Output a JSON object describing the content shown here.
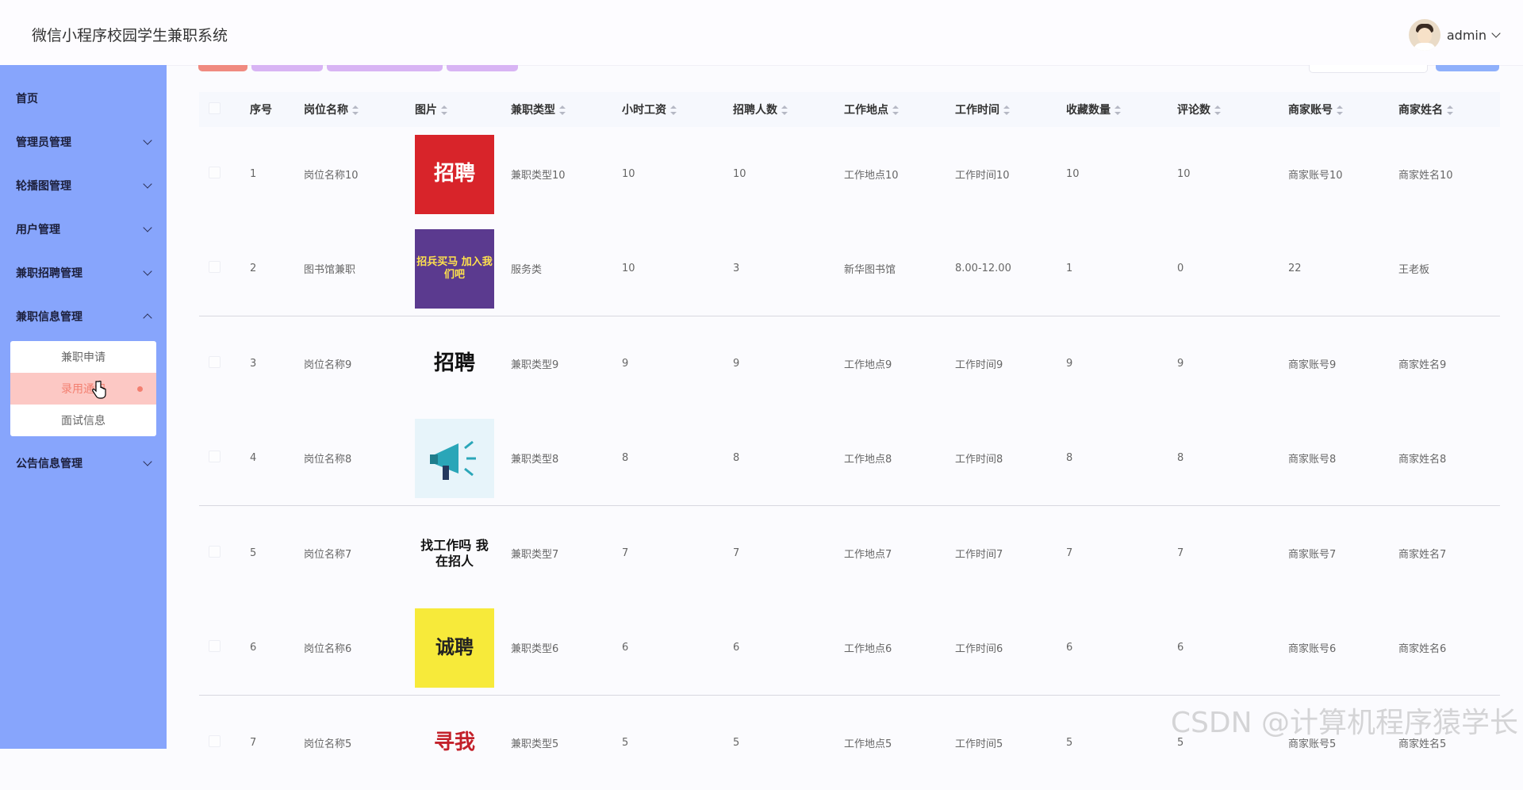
{
  "app": {
    "title": "微信小程序校园学生兼职系统"
  },
  "user": {
    "name": "admin"
  },
  "sidebar": {
    "items": [
      {
        "label": "首页"
      },
      {
        "label": "管理员管理"
      },
      {
        "label": "轮播图管理"
      },
      {
        "label": "用户管理"
      },
      {
        "label": "兼职招聘管理"
      },
      {
        "label": "兼职信息管理"
      },
      {
        "label": "公告信息管理"
      }
    ],
    "submenu": [
      {
        "label": "兼职申请"
      },
      {
        "label": "录用通知"
      },
      {
        "label": "面试信息"
      }
    ]
  },
  "colors": {
    "sidebar": "#87a5fc",
    "accent": "#f37f70",
    "active_bg": "#fcc8c4",
    "header_bg": "#f6f8fd"
  },
  "table": {
    "headers": [
      "序号",
      "岗位名称",
      "图片",
      "兼职类型",
      "小时工资",
      "招聘人数",
      "工作地点",
      "工作时间",
      "收藏数量",
      "评论数",
      "商家账号",
      "商家姓名"
    ],
    "rows": [
      [
        "1",
        "岗位名称10",
        "招聘",
        "兼职类型10",
        "10",
        "10",
        "工作地点10",
        "工作时间10",
        "10",
        "10",
        "商家账号10",
        "商家姓名10"
      ],
      [
        "2",
        "图书馆兼职",
        "招兵买马 加入我们吧",
        "服务类",
        "10",
        "3",
        "新华图书馆",
        "8.00-12.00",
        "1",
        "0",
        "22",
        "王老板"
      ],
      [
        "3",
        "岗位名称9",
        "招聘",
        "兼职类型9",
        "9",
        "9",
        "工作地点9",
        "工作时间9",
        "9",
        "9",
        "商家账号9",
        "商家姓名9"
      ],
      [
        "4",
        "岗位名称8",
        "",
        "兼职类型8",
        "8",
        "8",
        "工作地点8",
        "工作时间8",
        "8",
        "8",
        "商家账号8",
        "商家姓名8"
      ],
      [
        "5",
        "岗位名称7",
        "找工作吗 我在招人",
        "兼职类型7",
        "7",
        "7",
        "工作地点7",
        "工作时间7",
        "7",
        "7",
        "商家账号7",
        "商家姓名7"
      ],
      [
        "6",
        "岗位名称6",
        "诚聘",
        "兼职类型6",
        "6",
        "6",
        "工作地点6",
        "工作时间6",
        "6",
        "6",
        "商家账号6",
        "商家姓名6"
      ],
      [
        "7",
        "岗位名称5",
        "寻我",
        "兼职类型5",
        "5",
        "5",
        "工作地点5",
        "工作时间5",
        "5",
        "5",
        "商家账号5",
        "商家姓名5"
      ]
    ]
  },
  "watermark": "CSDN @计算机程序猿学长"
}
